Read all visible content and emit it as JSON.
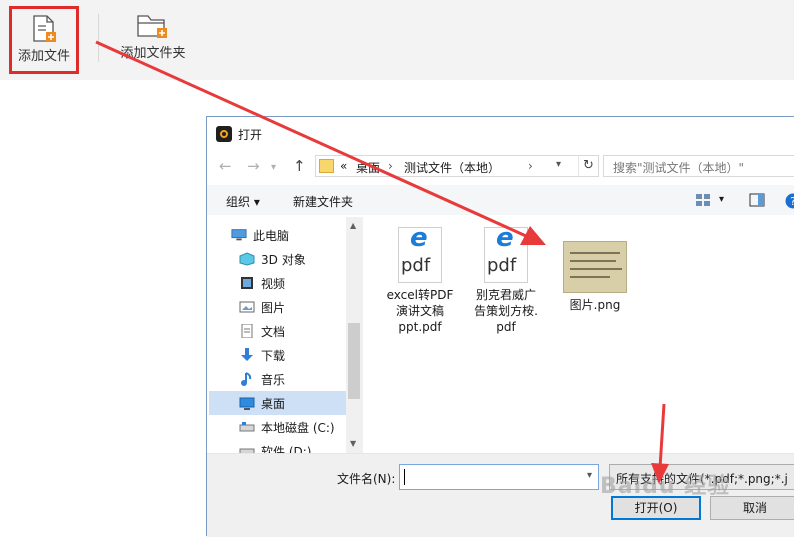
{
  "toolbar": {
    "add_file": "添加文件",
    "add_folder": "添加文件夹"
  },
  "dialog": {
    "title": "打开",
    "address": {
      "prefix": "«",
      "crumbs": [
        "桌面",
        "测试文件（本地）"
      ]
    },
    "search_placeholder": "搜索\"测试文件（本地）\"",
    "commands": {
      "organize": "组织 ▾",
      "new_folder": "新建文件夹"
    },
    "tree": [
      {
        "label": "此电脑",
        "icon": "computer-icon"
      },
      {
        "label": "3D 对象",
        "icon": "cube-icon"
      },
      {
        "label": "视频",
        "icon": "video-icon"
      },
      {
        "label": "图片",
        "icon": "pictures-icon"
      },
      {
        "label": "文档",
        "icon": "document-icon"
      },
      {
        "label": "下载",
        "icon": "download-icon"
      },
      {
        "label": "音乐",
        "icon": "music-icon"
      },
      {
        "label": "桌面",
        "icon": "desktop-icon",
        "selected": true
      },
      {
        "label": "本地磁盘 (C:)",
        "icon": "drive-icon"
      },
      {
        "label": "软件 (D:)",
        "icon": "drive-icon"
      }
    ],
    "files": [
      {
        "name": "excel转PDF演讲文稿ppt.pdf",
        "lines": [
          "excel转PDF",
          "演讲文稿",
          "ppt.pdf"
        ],
        "type": "pdf",
        "icon_text": "e",
        "icon_sub": "pdf"
      },
      {
        "name": "别克君威广告策划方桉.pdf",
        "lines": [
          "别克君威广",
          "告策划方桉.",
          "pdf"
        ],
        "type": "pdf",
        "icon_text": "e",
        "icon_sub": "pdf"
      },
      {
        "name": "图片.png",
        "lines": [
          "图片.png"
        ],
        "type": "image"
      }
    ],
    "filename_label": "文件名(N):",
    "filename_value": "",
    "filetype_value": "所有支持的文件(*.pdf;*.png;*.j",
    "open_button": "打开(O)",
    "cancel_button": "取消"
  },
  "watermark": "Baidu 经验",
  "colors": {
    "annotation_red": "#e83a3a",
    "highlight_border": "#e02b2b",
    "selection": "#cde0f5",
    "primary_button_border": "#0078d7"
  }
}
